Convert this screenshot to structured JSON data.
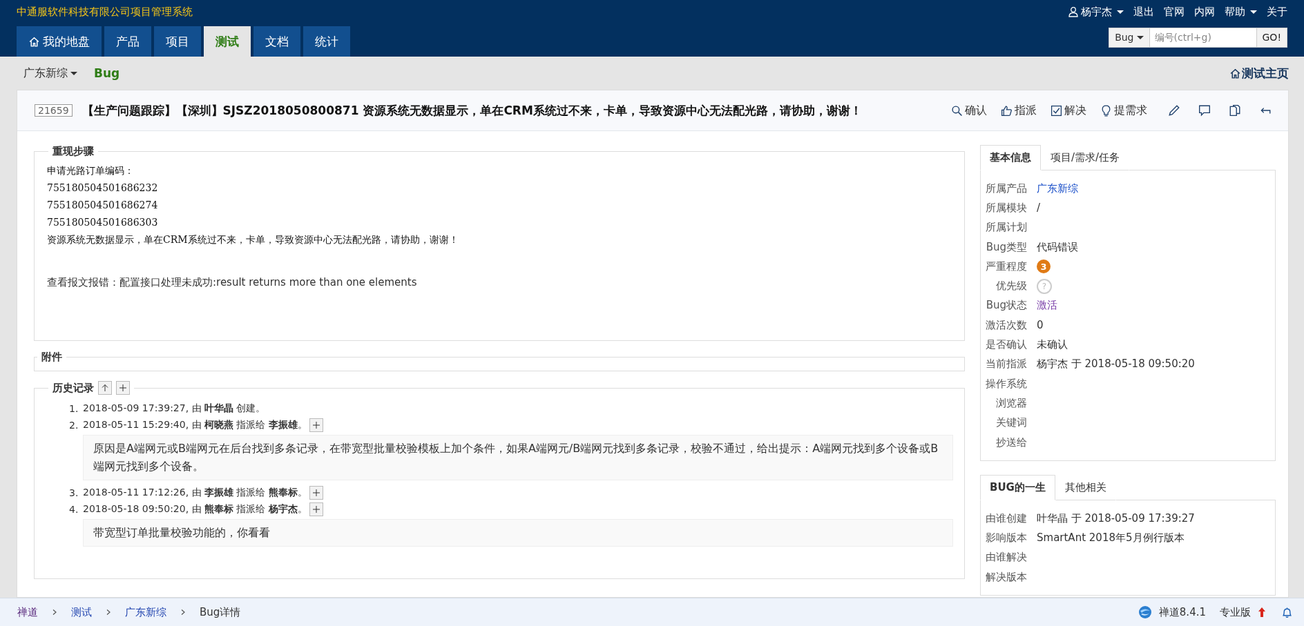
{
  "header": {
    "title": "中通服软件科技有限公司项目管理系统",
    "user": "杨宇杰",
    "links": [
      "退出",
      "官网",
      "内网"
    ],
    "help": "帮助",
    "about": "关于"
  },
  "nav": [
    {
      "label": "我的地盘",
      "selected": false,
      "home": true
    },
    {
      "label": "产品",
      "selected": false
    },
    {
      "label": "项目",
      "selected": false
    },
    {
      "label": "测试",
      "selected": true
    },
    {
      "label": "文档",
      "selected": false
    },
    {
      "label": "统计",
      "selected": false
    }
  ],
  "search": {
    "type": "Bug",
    "placeholder": "编号(ctrl+g)",
    "button": "GO!"
  },
  "subnav": {
    "product": "广东新综",
    "current": "Bug",
    "home": "测试主页"
  },
  "bug": {
    "id": "21659",
    "title": "【生产问题跟踪】【深圳】SJSZ2018050800871 资源系统无数据显示，单在CRM系统过不来，卡单，导致资源中心无法配光路，请协助，谢谢！"
  },
  "actions": [
    {
      "label": "确认"
    },
    {
      "label": "指派"
    },
    {
      "label": "解决"
    },
    {
      "label": "提需求"
    }
  ],
  "steps": {
    "legend": "重现步骤",
    "lines": [
      "申请光路订单编码：",
      "755180504501686232",
      "755180504501686274",
      "755180504501686303",
      "资源系统无数据显示，单在CRM系统过不来，卡单，导致资源中心无法配光路，请协助，谢谢！"
    ],
    "note": "查看报文报错：配置接口处理未成功:result returns more than one elements"
  },
  "files": {
    "legend": "附件"
  },
  "history": {
    "legend": "历史记录",
    "entries": [
      {
        "number": "1.",
        "text": "2018-05-09 17:39:27, 由 **叶华晶** 创建。",
        "expandable": false
      },
      {
        "number": "2.",
        "text": "2018-05-11 15:29:40, 由 **柯晓燕** 指派给 **李振雄**。",
        "expandable": true,
        "comment": "原因是A端网元或B端网元在后台找到多条记录，在带宽型批量校验模板上加个条件，如果A端网元/B端网元找到多条记录，校验不通过，给出提示：A端网元找到多个设备或B端网元找到多个设备。"
      },
      {
        "number": "3.",
        "text": "2018-05-11 17:12:26, 由 **李振雄** 指派给 **熊奉标**。",
        "expandable": true
      },
      {
        "number": "4.",
        "text": "2018-05-18 09:50:20, 由 **熊奉标** 指派给 **杨宇杰**。",
        "expandable": true,
        "comment": "带宽型订单批量校验功能的，你看看"
      }
    ]
  },
  "panels": [
    {
      "tabs": [
        {
          "label": "基本信息",
          "selected": true
        },
        {
          "label": "项目/需求/任务",
          "selected": false
        }
      ],
      "fields": [
        {
          "label": "所属产品",
          "value": "广东新综",
          "kind": "link"
        },
        {
          "label": "所属模块",
          "value": "/",
          "kind": "text"
        },
        {
          "label": "所属计划"
        },
        {
          "label": "Bug类型",
          "value": "代码错误",
          "kind": "text"
        },
        {
          "label": "严重程度",
          "value": "3",
          "kind": "severity"
        },
        {
          "label": "优先级",
          "value": "?",
          "kind": "priority"
        },
        {
          "label": "Bug状态",
          "value": "激活",
          "kind": "status"
        },
        {
          "label": "激活次数",
          "value": "0",
          "kind": "text"
        },
        {
          "label": "是否确认",
          "value": "未确认",
          "kind": "text"
        },
        {
          "label": "当前指派",
          "value": "杨宇杰 于 2018-05-18 09:50:20",
          "kind": "text"
        },
        {
          "label": "操作系统"
        },
        {
          "label": "浏览器"
        },
        {
          "label": "关键词"
        },
        {
          "label": "抄送给"
        }
      ]
    },
    {
      "tabs": [
        {
          "label": "BUG的一生",
          "selected": true
        },
        {
          "label": "其他相关",
          "selected": false
        }
      ],
      "fields": [
        {
          "label": "由谁创建",
          "value": "叶华晶 于 2018-05-09 17:39:27",
          "kind": "text"
        },
        {
          "label": "影响版本",
          "value": "SmartAnt 2018年5月例行版本",
          "kind": "text"
        },
        {
          "label": "由谁解决"
        },
        {
          "label": "解决版本"
        }
      ]
    }
  ],
  "breadcrumb": [
    "禅道",
    "测试",
    "广东新综",
    "Bug详情"
  ],
  "footer": {
    "version": "禅道8.4.1",
    "edition": "专业版"
  }
}
